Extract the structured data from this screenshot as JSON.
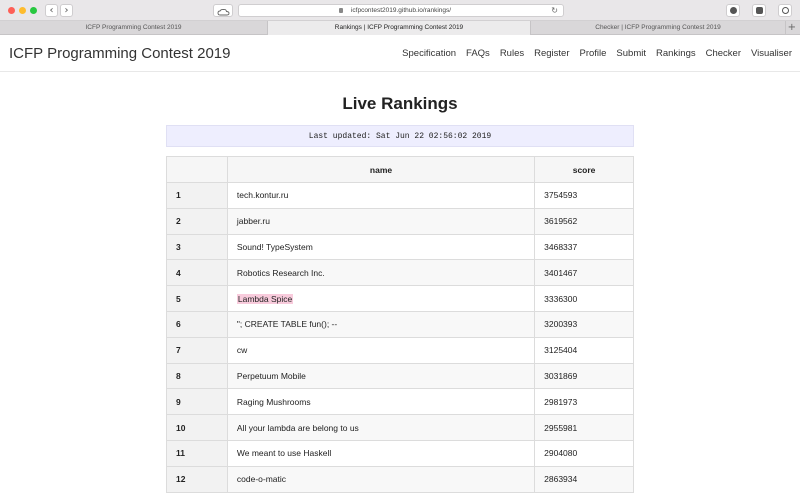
{
  "browser": {
    "url": "icfpcontest2019.github.io/rankings/",
    "tabs": [
      {
        "label": "ICFP Programming Contest 2019"
      },
      {
        "label": "Rankings | ICFP Programming Contest 2019"
      },
      {
        "label": "Checker | ICFP Programming Contest 2019"
      }
    ],
    "new_tab": "+",
    "back": "‹",
    "forward": "›",
    "reload": "↻"
  },
  "site": {
    "brand": "ICFP Programming Contest 2019",
    "nav": [
      "Specification",
      "FAQs",
      "Rules",
      "Register",
      "Profile",
      "Submit",
      "Rankings",
      "Checker",
      "Visualiser"
    ]
  },
  "main": {
    "title": "Live Rankings",
    "updated": "Last updated: Sat Jun 22 02:56:02 2019",
    "columns": {
      "rank": "",
      "name": "name",
      "score": "score"
    },
    "rows": [
      {
        "rank": "1",
        "name": "tech.kontur.ru",
        "score": "3754593"
      },
      {
        "rank": "2",
        "name": "jabber.ru",
        "score": "3619562"
      },
      {
        "rank": "3",
        "name": "Sound! TypeSystem",
        "score": "3468337"
      },
      {
        "rank": "4",
        "name": "Robotics Research Inc.",
        "score": "3401467"
      },
      {
        "rank": "5",
        "name": "Lambda Spice",
        "score": "3336300",
        "highlight": true
      },
      {
        "rank": "6",
        "name": "\"; CREATE TABLE fun(); --",
        "score": "3200393"
      },
      {
        "rank": "7",
        "name": "cw",
        "score": "3125404"
      },
      {
        "rank": "8",
        "name": "Perpetuum Mobile",
        "score": "3031869"
      },
      {
        "rank": "9",
        "name": "Raging Mushrooms",
        "score": "2981973"
      },
      {
        "rank": "10",
        "name": "All your lambda are belong to us",
        "score": "2955981"
      },
      {
        "rank": "11",
        "name": "We meant to use Haskell",
        "score": "2904080"
      },
      {
        "rank": "12",
        "name": "code-o-matic",
        "score": "2863934"
      }
    ]
  },
  "colors": {
    "highlight": "#f8cbdc",
    "updated_bg": "#eeeefe"
  }
}
